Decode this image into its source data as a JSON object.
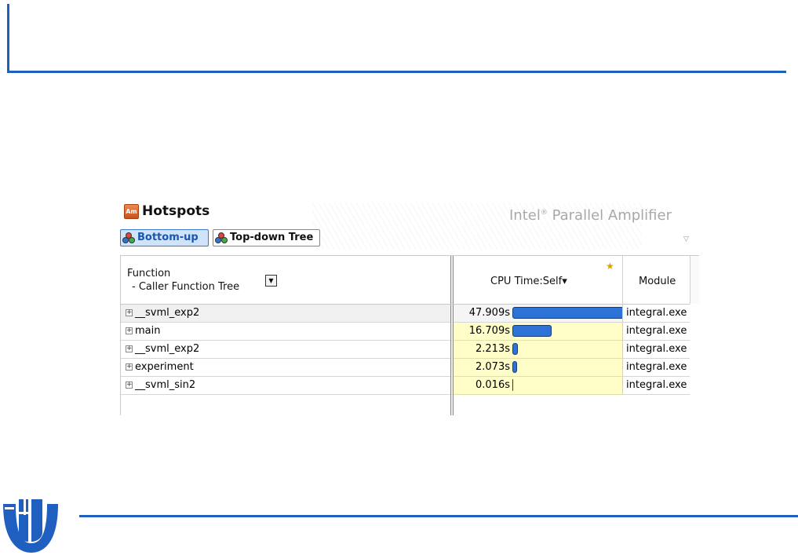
{
  "header": {
    "title": "Hotspots",
    "icon_text": "Am",
    "brand": "Intel",
    "brand_mark": "®",
    "brand_rest": " Parallel Amplifier"
  },
  "views": {
    "bottom_up": "Bottom-up",
    "top_down": "Top-down Tree"
  },
  "columns": {
    "function_line1": "Function",
    "function_line2": "- Caller Function Tree",
    "cpu": "CPU Time:Self",
    "cpu_sort_glyph": "▾",
    "module": "Module"
  },
  "rows": [
    {
      "function": "__svml_exp2",
      "cpu_time": "47.909s",
      "cpu_seconds": 47.909,
      "module": "integral.exe",
      "selected": true
    },
    {
      "function": "main",
      "cpu_time": "16.709s",
      "cpu_seconds": 16.709,
      "module": "integral.exe",
      "selected": false
    },
    {
      "function": "__svml_exp2",
      "cpu_time": "2.213s",
      "cpu_seconds": 2.213,
      "module": "integral.exe",
      "selected": false
    },
    {
      "function": "experiment",
      "cpu_time": "2.073s",
      "cpu_seconds": 2.073,
      "module": "integral.exe",
      "selected": false
    },
    {
      "function": "__svml_sin2",
      "cpu_time": "0.016s",
      "cpu_seconds": 0.016,
      "module": "integral.exe",
      "selected": false
    }
  ],
  "icons": {
    "expand": "plus-box-icon",
    "sort": "chevron-down-icon",
    "star": "star-icon",
    "views": "molecule-icon",
    "collapse": "triangle-down-icon"
  },
  "colors": {
    "accent": "#1f5fbf",
    "bar": "#2d72d6",
    "cpu_bg": "#fffdc8",
    "active_button": "#cfe3fb"
  }
}
